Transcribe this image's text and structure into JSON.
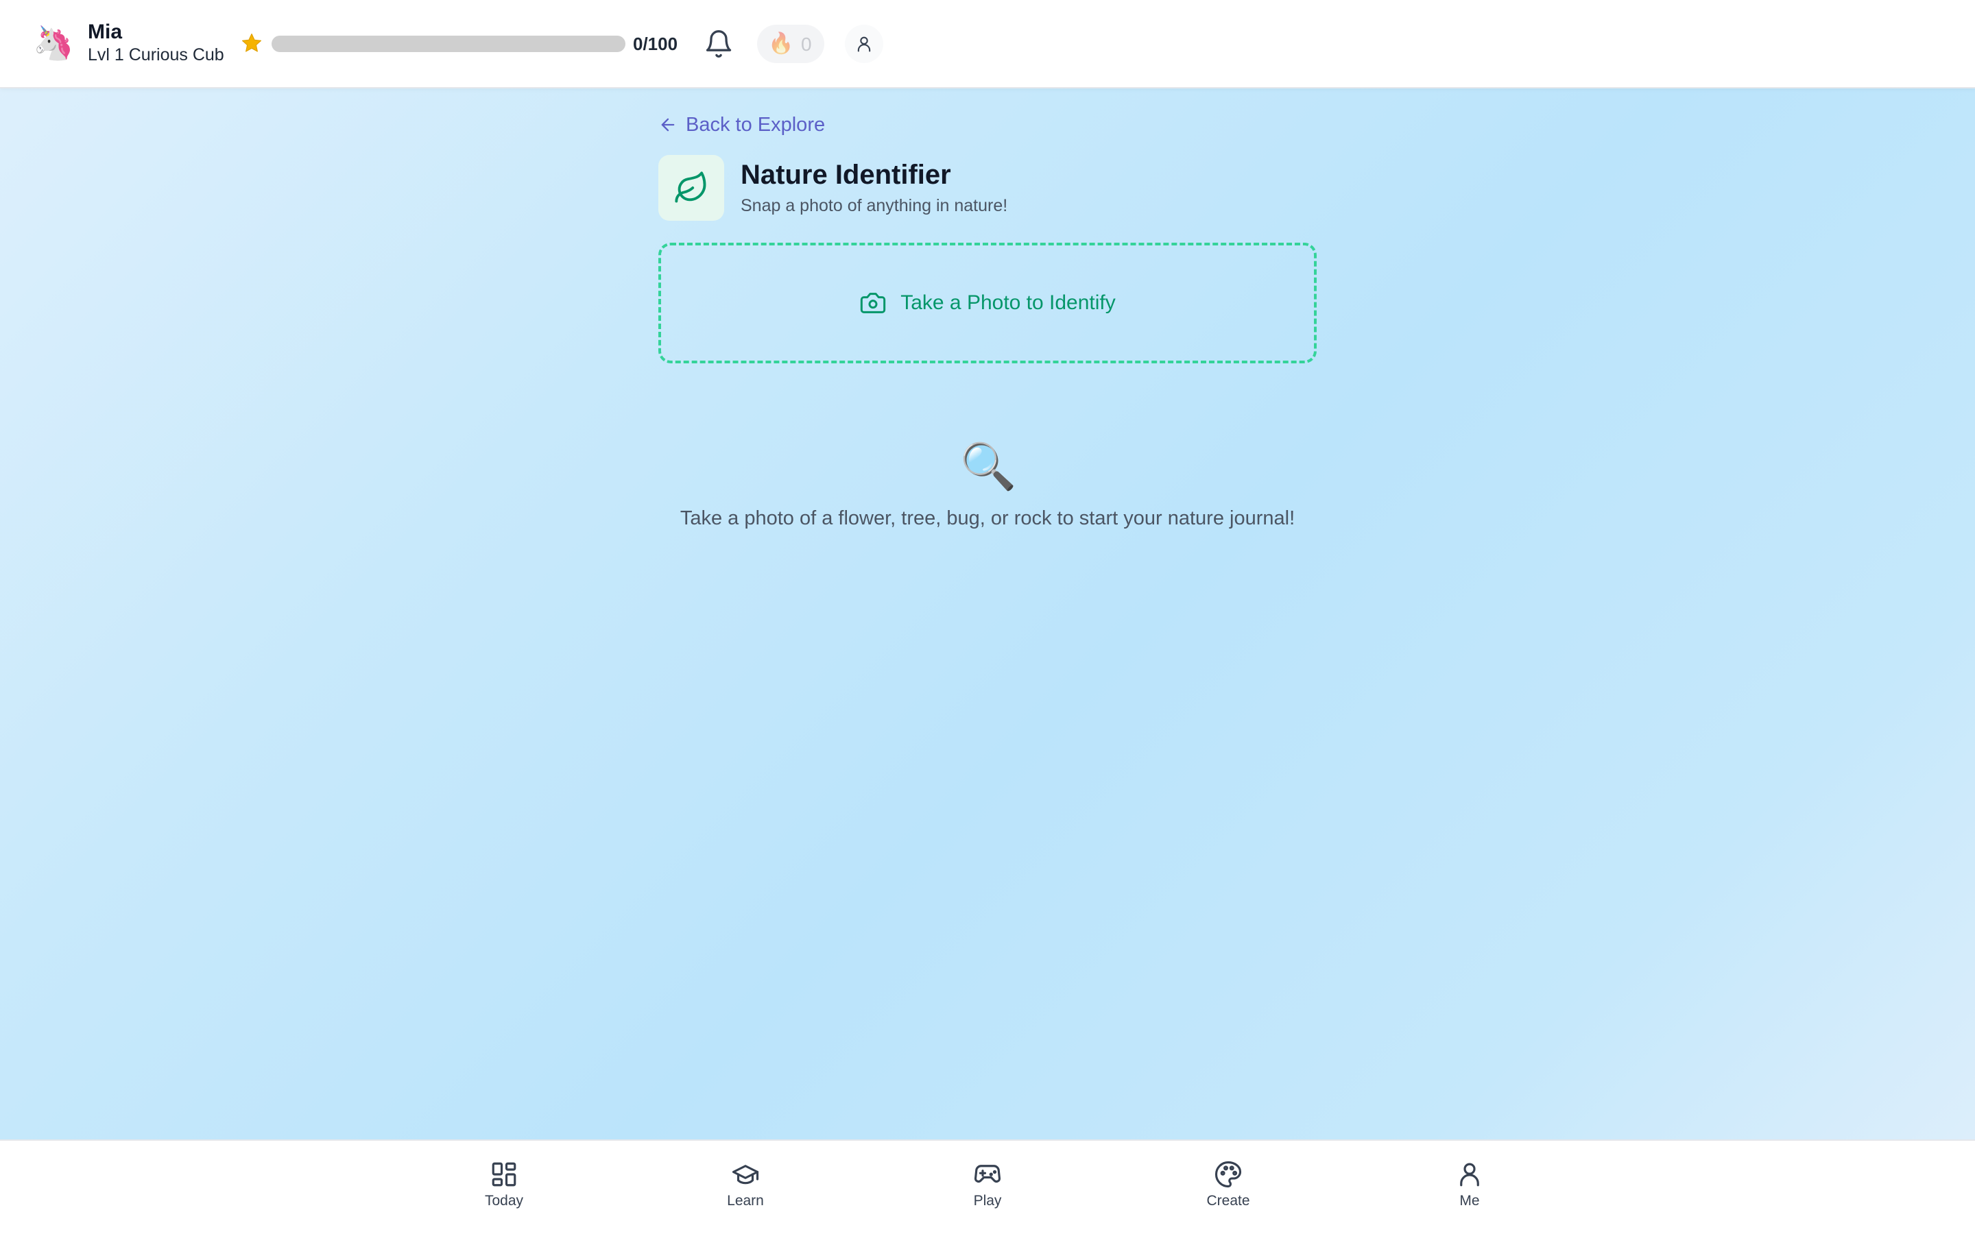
{
  "header": {
    "avatar_emoji": "🦄",
    "user_name": "Mia",
    "user_level": "Lvl 1 Curious Cub",
    "xp_text": "0/100",
    "xp_progress": 0,
    "streak_icon": "🔥",
    "streak_count": "0",
    "icons": [
      "star-icon",
      "bell-icon",
      "flame-icon",
      "profile-icon"
    ]
  },
  "main": {
    "back_label": "Back to Explore",
    "title": "Nature Identifier",
    "subtitle": "Snap a photo of anything in nature!",
    "photo_button_label": "Take a Photo to Identify",
    "empty_icon": "🔍",
    "empty_text": "Take a photo of a flower, tree, bug, or rock to start your nature journal!"
  },
  "nav": {
    "items": [
      {
        "label": "Today",
        "icon": "grid-icon"
      },
      {
        "label": "Learn",
        "icon": "graduation-cap-icon"
      },
      {
        "label": "Play",
        "icon": "gamepad-icon"
      },
      {
        "label": "Create",
        "icon": "palette-icon"
      },
      {
        "label": "Me",
        "icon": "user-icon"
      }
    ]
  },
  "colors": {
    "accent_green": "#059669",
    "dashed_border": "#34d399",
    "link_indigo": "#5b5fc7",
    "star": "#f5b300"
  }
}
